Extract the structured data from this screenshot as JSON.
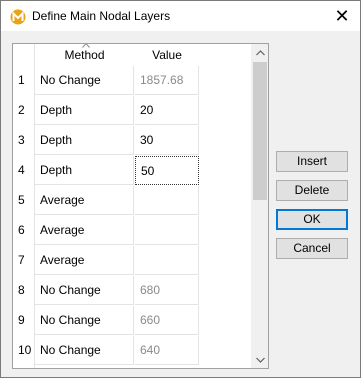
{
  "window": {
    "title": "Define Main Nodal Layers"
  },
  "grid": {
    "columns": {
      "method": "Method",
      "value": "Value"
    },
    "rows": [
      {
        "num": "1",
        "method": "No Change",
        "value": "1857.68",
        "value_muted": true
      },
      {
        "num": "2",
        "method": "Depth",
        "value": "20",
        "value_muted": false
      },
      {
        "num": "3",
        "method": "Depth",
        "value": "30",
        "value_muted": false
      },
      {
        "num": "4",
        "method": "Depth",
        "value": "50",
        "value_muted": false,
        "focused": true
      },
      {
        "num": "5",
        "method": "Average",
        "value": "",
        "value_muted": false
      },
      {
        "num": "6",
        "method": "Average",
        "value": "",
        "value_muted": false
      },
      {
        "num": "7",
        "method": "Average",
        "value": "",
        "value_muted": false
      },
      {
        "num": "8",
        "method": "No Change",
        "value": "680",
        "value_muted": true
      },
      {
        "num": "9",
        "method": "No Change",
        "value": "660",
        "value_muted": true
      },
      {
        "num": "10",
        "method": "No Change",
        "value": "640",
        "value_muted": true
      }
    ]
  },
  "buttons": {
    "insert": "Insert",
    "delete": "Delete",
    "ok": "OK",
    "cancel": "Cancel"
  },
  "colors": {
    "accent": "#0078d7",
    "muted_text": "#8a8a8a",
    "app_icon": "#e8a317"
  }
}
